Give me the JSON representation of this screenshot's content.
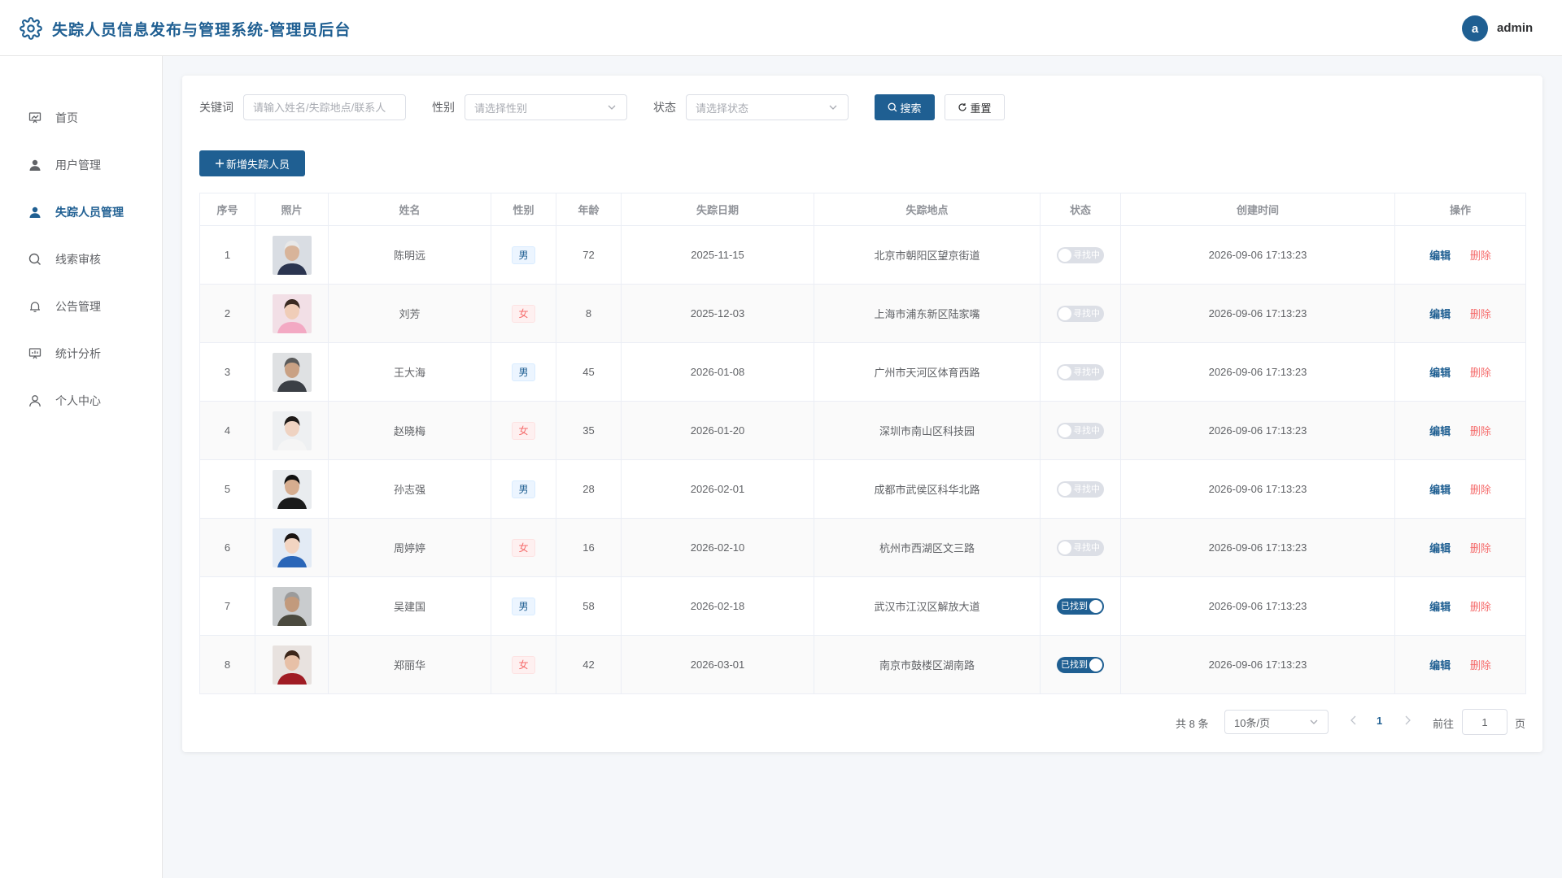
{
  "header": {
    "title": "失踪人员信息发布与管理系统-管理员后台",
    "avatar_letter": "a",
    "username": "admin"
  },
  "sidebar": {
    "items": [
      {
        "label": "首页",
        "icon": "dashboard-icon",
        "active": false
      },
      {
        "label": "用户管理",
        "icon": "user-icon",
        "active": false
      },
      {
        "label": "失踪人员管理",
        "icon": "user-icon",
        "active": true
      },
      {
        "label": "线索审核",
        "icon": "search-icon",
        "active": false
      },
      {
        "label": "公告管理",
        "icon": "bell-icon",
        "active": false
      },
      {
        "label": "统计分析",
        "icon": "chart-icon",
        "active": false
      },
      {
        "label": "个人中心",
        "icon": "user-outline-icon",
        "active": false
      }
    ]
  },
  "filters": {
    "keyword_label": "关键词",
    "keyword_placeholder": "请输入姓名/失踪地点/联系人",
    "gender_label": "性别",
    "gender_placeholder": "请选择性别",
    "status_label": "状态",
    "status_placeholder": "请选择状态",
    "search_label": "搜索",
    "reset_label": "重置"
  },
  "add_button": "新增失踪人员",
  "table": {
    "columns": [
      "序号",
      "照片",
      "姓名",
      "性别",
      "年龄",
      "失踪日期",
      "失踪地点",
      "状态",
      "创建时间",
      "操作"
    ],
    "rows": [
      {
        "no": "1",
        "name": "陈明远",
        "gender": "男",
        "age": "72",
        "date": "2025-11-15",
        "place": "北京市朝阳区望京街道",
        "status": "寻找中",
        "found": false,
        "created": "2026-09-06 17:13:23"
      },
      {
        "no": "2",
        "name": "刘芳",
        "gender": "女",
        "age": "8",
        "date": "2025-12-03",
        "place": "上海市浦东新区陆家嘴",
        "status": "寻找中",
        "found": false,
        "created": "2026-09-06 17:13:23"
      },
      {
        "no": "3",
        "name": "王大海",
        "gender": "男",
        "age": "45",
        "date": "2026-01-08",
        "place": "广州市天河区体育西路",
        "status": "寻找中",
        "found": false,
        "created": "2026-09-06 17:13:23"
      },
      {
        "no": "4",
        "name": "赵晓梅",
        "gender": "女",
        "age": "35",
        "date": "2026-01-20",
        "place": "深圳市南山区科技园",
        "status": "寻找中",
        "found": false,
        "created": "2026-09-06 17:13:23"
      },
      {
        "no": "5",
        "name": "孙志强",
        "gender": "男",
        "age": "28",
        "date": "2026-02-01",
        "place": "成都市武侯区科华北路",
        "status": "寻找中",
        "found": false,
        "created": "2026-09-06 17:13:23"
      },
      {
        "no": "6",
        "name": "周婷婷",
        "gender": "女",
        "age": "16",
        "date": "2026-02-10",
        "place": "杭州市西湖区文三路",
        "status": "寻找中",
        "found": false,
        "created": "2026-09-06 17:13:23"
      },
      {
        "no": "7",
        "name": "吴建国",
        "gender": "男",
        "age": "58",
        "date": "2026-02-18",
        "place": "武汉市江汉区解放大道",
        "status": "已找到",
        "found": true,
        "created": "2026-09-06 17:13:23"
      },
      {
        "no": "8",
        "name": "郑丽华",
        "gender": "女",
        "age": "42",
        "date": "2026-03-01",
        "place": "南京市鼓楼区湖南路",
        "status": "已找到",
        "found": true,
        "created": "2026-09-06 17:13:23"
      }
    ],
    "edit_label": "编辑",
    "delete_label": "删除"
  },
  "pagination": {
    "total": "共 8 条",
    "page_size": "10条/页",
    "current_page": "1",
    "goto_label": "前往",
    "goto_value": "1",
    "page_suffix": "页"
  },
  "colors": {
    "primary": "#1f5f92",
    "danger": "#f56c6c",
    "background": "#f5f7fa"
  }
}
